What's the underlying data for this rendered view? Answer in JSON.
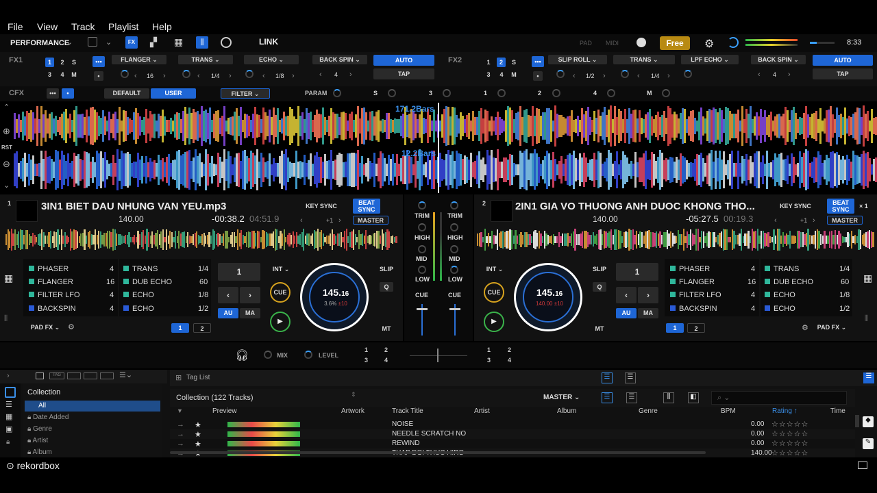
{
  "menu": [
    "File",
    "View",
    "Track",
    "Playlist",
    "Help"
  ],
  "toolbar": {
    "mode": "PERFORMANCE",
    "link": "LINK",
    "pad": "PAD",
    "midi": "MIDI",
    "plan": "Free",
    "clock": "8:33"
  },
  "fx1": {
    "label": "FX1",
    "banks": [
      "1",
      "2",
      "S",
      "3",
      "4",
      "M"
    ],
    "effects": [
      "FLANGER",
      "TRANS",
      "ECHO"
    ],
    "values": [
      "16",
      "1/4",
      "1/8"
    ],
    "beat_fx": "BACK SPIN",
    "beat_val": "4",
    "auto": "AUTO",
    "tap": "TAP"
  },
  "fx2": {
    "label": "FX2",
    "banks": [
      "1",
      "2",
      "S",
      "3",
      "4",
      "M"
    ],
    "effects": [
      "SLIP ROLL",
      "TRANS",
      "LPF ECHO"
    ],
    "values": [
      "1/2",
      "1/4",
      "1/8"
    ],
    "beat_fx": "BACK SPIN",
    "beat_val": "4",
    "auto": "AUTO",
    "tap": "TAP"
  },
  "cfx": {
    "label": "CFX",
    "default": "DEFAULT",
    "user": "USER",
    "filter": "FILTER",
    "param": "PARAM",
    "keys": [
      "S",
      "3",
      "1",
      "2",
      "4",
      "M"
    ]
  },
  "wave": {
    "bars_top": "171.2Bars",
    "bars_bottom": "12.2Bars",
    "rst": "RST"
  },
  "deck1": {
    "num": "1",
    "title": "3IN1 BIET DAU NHUNG VAN YEU.mp3",
    "bpm": "140.00",
    "remain": "-00:38.2",
    "elapsed": "04:51.9",
    "key_sync": "KEY SYNC",
    "beat_sync": "BEAT SYNC",
    "master": "MASTER",
    "plus": "+1",
    "pads_left": [
      {
        "name": "PHASER",
        "val": "4"
      },
      {
        "name": "FLANGER",
        "val": "16"
      },
      {
        "name": "FILTER LFO",
        "val": "4"
      },
      {
        "name": "BACKSPIN",
        "val": "4"
      }
    ],
    "pads_right": [
      {
        "name": "TRANS",
        "val": "1/4"
      },
      {
        "name": "DUB ECHO",
        "val": "60"
      },
      {
        "name": "ECHO",
        "val": "1/8"
      },
      {
        "name": "ECHO",
        "val": "1/2"
      }
    ],
    "loop": "1",
    "int": "INT",
    "cue": "CUE",
    "au": "AU",
    "ma": "MA",
    "slip": "SLIP",
    "q": "Q",
    "mt": "MT",
    "jog_bpm": "145.",
    "jog_bpm_dec": "16",
    "jog_pct": "3.6%",
    "jog_range": "±10",
    "padfx": "PAD FX",
    "pages": [
      "1",
      "2"
    ]
  },
  "deck2": {
    "num": "2",
    "title": "2IN1 GIA VO THUONG ANH DUOC KHONG THO...",
    "bpm": "140.00",
    "remain": "-05:27.5",
    "elapsed": "00:19.3",
    "key_sync": "KEY SYNC",
    "beat_sync": "BEAT SYNC",
    "master": "MASTER",
    "plus": "+1",
    "x1": "× 1",
    "pads_left": [
      {
        "name": "PHASER",
        "val": "4"
      },
      {
        "name": "FLANGER",
        "val": "16"
      },
      {
        "name": "FILTER LFO",
        "val": "4"
      },
      {
        "name": "BACKSPIN",
        "val": "4"
      }
    ],
    "pads_right": [
      {
        "name": "TRANS",
        "val": "1/4"
      },
      {
        "name": "DUB ECHO",
        "val": "60"
      },
      {
        "name": "ECHO",
        "val": "1/8"
      },
      {
        "name": "ECHO",
        "val": "1/2"
      }
    ],
    "loop": "1",
    "int": "INT",
    "cue": "CUE",
    "au": "AU",
    "ma": "MA",
    "slip": "SLIP",
    "q": "Q",
    "mt": "MT",
    "jog_bpm": "145.",
    "jog_bpm_dec": "16",
    "jog_pct": "140.00",
    "jog_range": "±10",
    "padfx": "PAD FX",
    "pages": [
      "1",
      "2"
    ]
  },
  "mixer": {
    "trim": "TRIM",
    "high": "HIGH",
    "mid": "MID",
    "low": "LOW",
    "cue": "CUE",
    "mix": "MIX",
    "level": "LEVEL",
    "assign": [
      "1",
      "2",
      "3",
      "4"
    ]
  },
  "browser": {
    "tag_list": "Tag List",
    "collection_count": "Collection (122 Tracks)",
    "master": "MASTER",
    "tree": [
      "Collection",
      "All",
      "Date Added",
      "Genre",
      "Artist",
      "Album"
    ],
    "columns": [
      "Preview",
      "Artwork",
      "Track Title",
      "Artist",
      "Album",
      "Genre",
      "BPM",
      "Rating",
      "Time"
    ],
    "rows": [
      {
        "title": "NOISE",
        "bpm": "0.00"
      },
      {
        "title": "NEEDLE SCRATCH NO",
        "bpm": "0.00"
      },
      {
        "title": "REWIND",
        "bpm": "0.00"
      },
      {
        "title": "THAP DOI THUC HIRO",
        "bpm": "140.00"
      }
    ]
  },
  "footer": {
    "brand": "rekordbox"
  },
  "colors": {
    "accent": "#1e66d6",
    "pad": "#2fb79b",
    "cue": "#d6a21e",
    "play": "#3ab34a"
  }
}
